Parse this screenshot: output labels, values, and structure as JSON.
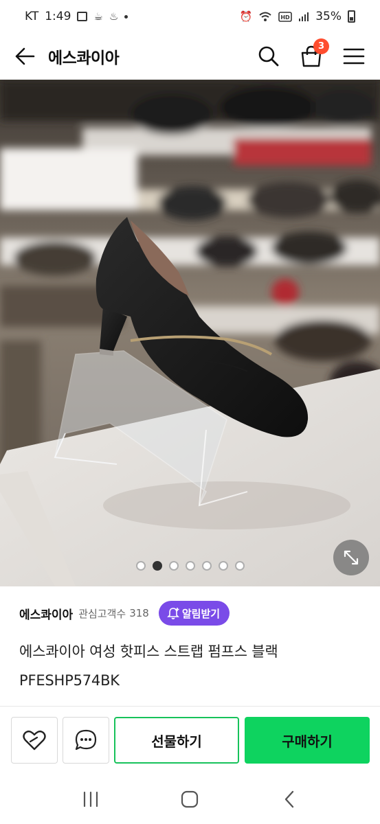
{
  "status_bar": {
    "carrier": "KT",
    "time": "1:49",
    "battery": "35%",
    "left_icons": [
      "gallery-icon",
      "coffee-icon",
      "app-icon",
      "dot-icon"
    ],
    "right_icons": [
      "alarm-icon",
      "wifi-icon",
      "hd-icon",
      "signal-icon",
      "battery-icon"
    ]
  },
  "header": {
    "title": "에스콰이아",
    "cart_count": "3",
    "icons": [
      "back-arrow-icon",
      "search-icon",
      "shopping-bag-icon",
      "menu-icon"
    ]
  },
  "product_image": {
    "description_icon": "expand-icon",
    "pager_total": 7,
    "pager_active_index": 1
  },
  "seller": {
    "name": "에스콰이아",
    "follower_label": "관심고객수",
    "follower_count": "318",
    "alert_button": "알림받기"
  },
  "product": {
    "title": "에스콰이아 여성 핫피스 스트랩 펌프스 블랙 PFESHP574BK"
  },
  "actions": {
    "gift_label": "선물하기",
    "buy_label": "구매하기",
    "icons": [
      "heart-icon",
      "chat-icon"
    ]
  },
  "colors": {
    "accent_purple": "#7a4be8",
    "buy_green": "#0ed35f",
    "badge_red": "#ff4d2e"
  }
}
